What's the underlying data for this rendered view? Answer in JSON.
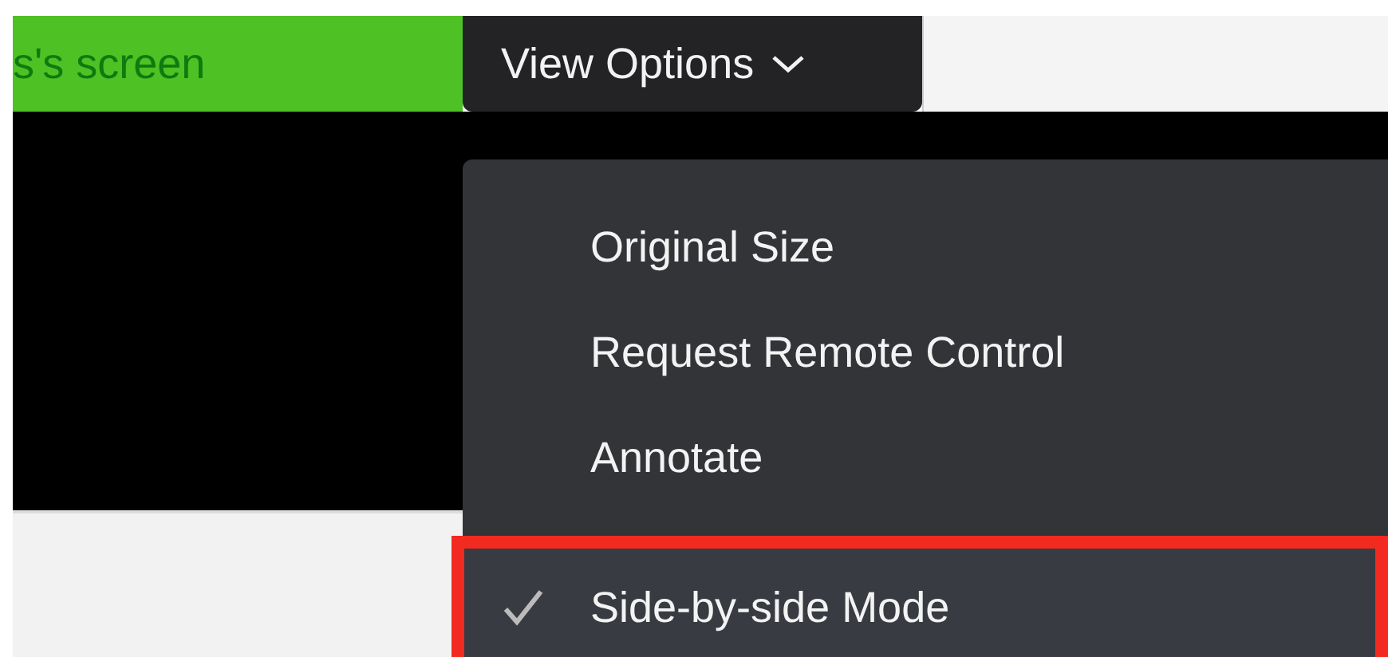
{
  "screen_label": "s's screen",
  "view_options": {
    "label": "View Options",
    "expanded": true
  },
  "menu": {
    "items": [
      {
        "label": "Original Size",
        "checked": false,
        "highlighted": false
      },
      {
        "label": "Request Remote Control",
        "checked": false,
        "highlighted": false
      },
      {
        "label": "Annotate",
        "checked": false,
        "highlighted": false
      },
      {
        "label": "Side-by-side Mode",
        "checked": true,
        "highlighted": true
      }
    ]
  }
}
